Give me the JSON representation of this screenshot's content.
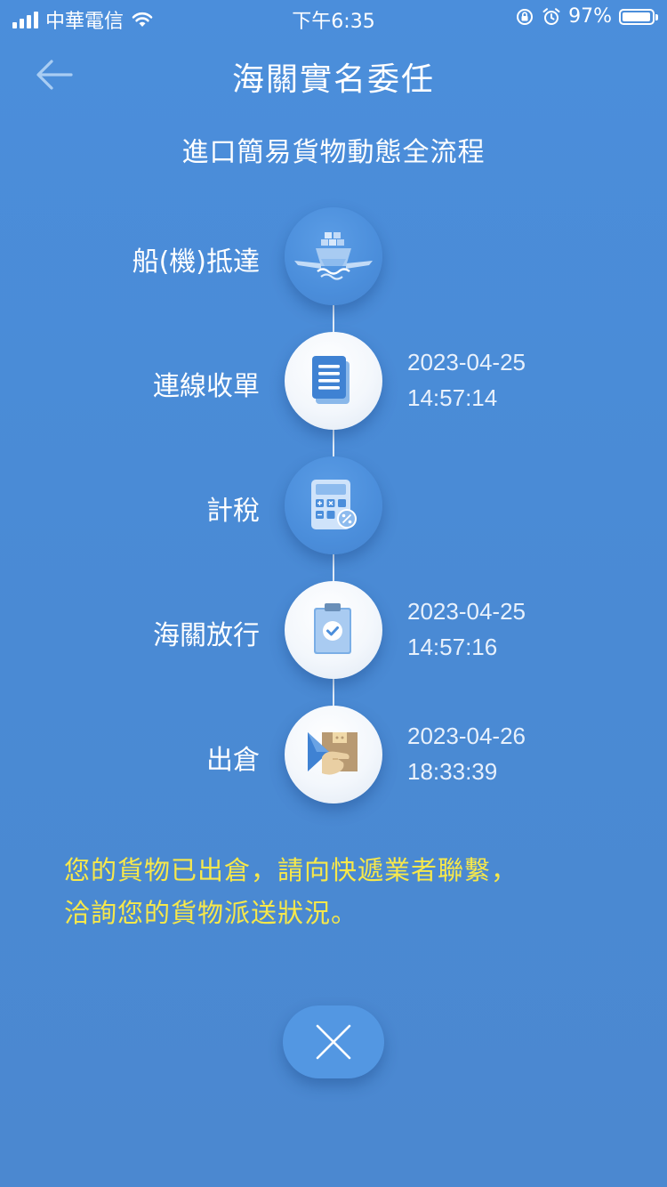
{
  "status_bar": {
    "carrier": "中華電信",
    "time": "下午6:35",
    "battery": "97%",
    "battery_level": 0.97,
    "icons": [
      "signal-icon",
      "wifi-icon",
      "rotation-lock-icon",
      "alarm-icon",
      "battery-icon"
    ]
  },
  "header": {
    "title": "海關實名委任",
    "back_icon": "arrow-left-icon"
  },
  "subtitle": "進口簡易貨物動態全流程",
  "steps": [
    {
      "label": "船(機)抵達",
      "icon": "ship-plane-icon",
      "state": "inactive",
      "date": "",
      "time": ""
    },
    {
      "label": "連線收單",
      "icon": "document-icon",
      "state": "active",
      "date": "2023-04-25",
      "time": "14:57:14"
    },
    {
      "label": "計稅",
      "icon": "calculator-icon",
      "state": "inactive",
      "date": "",
      "time": ""
    },
    {
      "label": "海關放行",
      "icon": "clipboard-check-icon",
      "state": "active",
      "date": "2023-04-25",
      "time": "14:57:16"
    },
    {
      "label": "出倉",
      "icon": "package-handover-icon",
      "state": "active",
      "date": "2023-04-26",
      "time": "18:33:39"
    }
  ],
  "notice": {
    "line1": "您的貨物已出倉，請向快遞業者聯繫，",
    "line2": "洽詢您的貨物派送狀況。"
  },
  "close_icon": "close-icon",
  "colors": {
    "background": "#4a8bd6",
    "notice_text": "#f7e84a",
    "text": "#ffffff"
  }
}
